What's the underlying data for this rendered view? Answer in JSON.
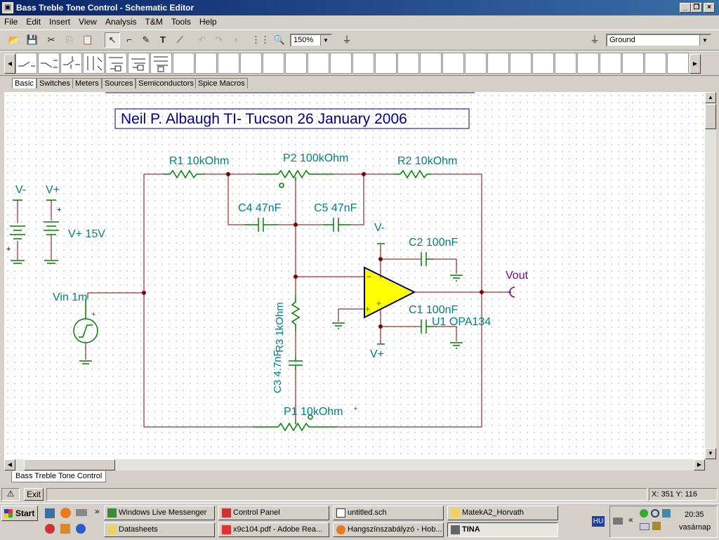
{
  "window": {
    "title": "Bass Treble Tone Control - Schematic Editor"
  },
  "menu": [
    "File",
    "Edit",
    "Insert",
    "View",
    "Analysis",
    "T&M",
    "Tools",
    "Help"
  ],
  "toolbar": {
    "zoom": "150%",
    "ground_select": "Ground"
  },
  "component_tabs": [
    "Basic",
    "Switches",
    "Meters",
    "Sources",
    "Semiconductors",
    "Spice Macros"
  ],
  "schematic": {
    "banner": "Neil P. Albaugh  TI- Tucson  26 January 2006",
    "labels": {
      "r1": "R1 10kOhm",
      "p2": "P2 100kOhm",
      "r2": "R2 10kOhm",
      "c4": "C4 47nF",
      "c5": "C5 47nF",
      "vminus_supply": "V-",
      "vplus_supply": "V+",
      "vplus_value": "V+ 15V",
      "vin": "Vin 1m",
      "vminus_opamp": "V-",
      "c2": "C2 100nF",
      "vout": "Vout",
      "c1": "C1 100nF",
      "u1": "U1 OPA134",
      "vplus_opamp": "V+",
      "r3": "R3 1kOhm",
      "c3": "C3 4.7nF",
      "p1": "P1 10kOhm",
      "star": "*"
    }
  },
  "sheet_tab": "Bass Treble Tone Control",
  "status": {
    "exit_label": "Exit",
    "coords": "X: 351  Y: 116"
  },
  "taskbar": {
    "start": "Start",
    "tasks_row1": [
      "Windows Live Messenger",
      "Control Panel",
      "untitled.sch",
      "MatekA2_Horvath"
    ],
    "tasks_row2": [
      "Datasheets",
      "x9c104.pdf - Adobe Rea...",
      "Hangszínszabályzó - Hob...",
      "TINA"
    ],
    "lang": "HU",
    "time": "20:35",
    "day": "vasárnap"
  },
  "colors": {
    "wire": "#800000",
    "component": "#008000",
    "label": "#008080",
    "banner": "#000080",
    "vout": "#800080",
    "opamp_fill": "#ffff00"
  }
}
